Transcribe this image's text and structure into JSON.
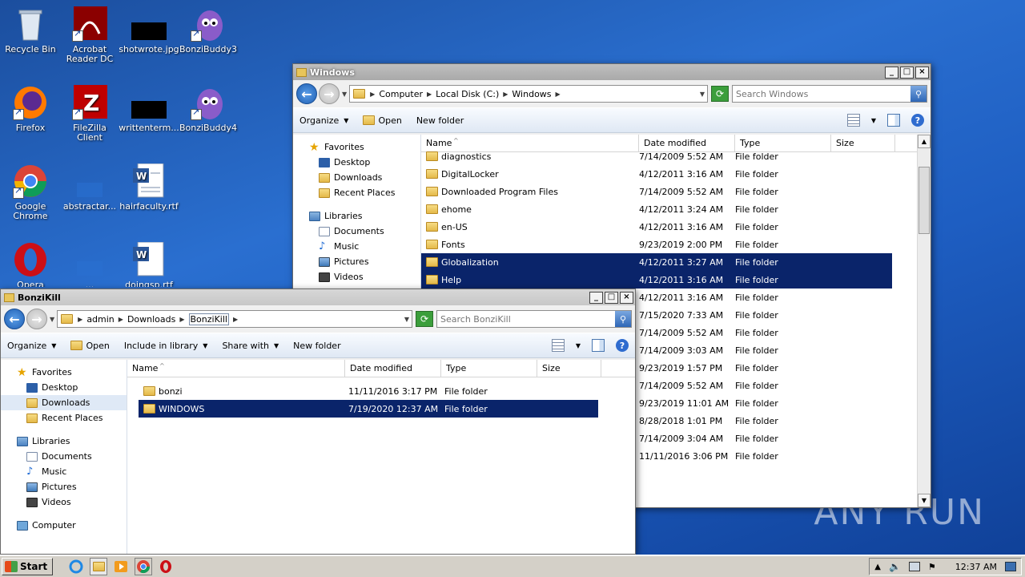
{
  "desktop": {
    "icons": [
      {
        "label": "Recycle Bin",
        "icon": "recycle-bin-icon"
      },
      {
        "label": "Acrobat Reader DC",
        "icon": "acrobat-icon"
      },
      {
        "label": "shotwrote.jpg",
        "icon": "image-file-icon"
      },
      {
        "label": "BonziBuddy3",
        "icon": "bonzibuddy-icon"
      },
      {
        "label": "Firefox",
        "icon": "firefox-icon"
      },
      {
        "label": "FileZilla Client",
        "icon": "filezilla-icon"
      },
      {
        "label": "writtenterm...",
        "icon": "image-file-icon"
      },
      {
        "label": "BonziBuddy4",
        "icon": "bonzibuddy-icon"
      },
      {
        "label": "Google Chrome",
        "icon": "chrome-icon"
      },
      {
        "label": "abstractar...",
        "icon": "file-icon"
      },
      {
        "label": "hairfaculty.rtf",
        "icon": "word-doc-icon"
      },
      {
        "label": "Opera",
        "icon": "opera-icon"
      },
      {
        "label": "...",
        "icon": "file-icon"
      },
      {
        "label": "doingsp.rtf",
        "icon": "word-doc-icon"
      }
    ],
    "watermark": "ANY RUN"
  },
  "windows_explorer": {
    "title": "Windows",
    "breadcrumb": [
      "Computer",
      "Local Disk (C:)",
      "Windows"
    ],
    "search_placeholder": "Search Windows",
    "toolbar": {
      "organize": "Organize",
      "open": "Open",
      "new_folder": "New folder"
    },
    "nav": {
      "favorites": "Favorites",
      "favorites_items": [
        "Desktop",
        "Downloads",
        "Recent Places"
      ],
      "libraries": "Libraries",
      "library_items": [
        "Documents",
        "Music",
        "Pictures",
        "Videos"
      ]
    },
    "columns": [
      "Name",
      "Date modified",
      "Type",
      "Size"
    ],
    "rows": [
      {
        "name": "diagnostics",
        "date": "7/14/2009 5:52 AM",
        "type": "File folder",
        "selected": false
      },
      {
        "name": "DigitalLocker",
        "date": "4/12/2011 3:16 AM",
        "type": "File folder",
        "selected": false
      },
      {
        "name": "Downloaded Program Files",
        "date": "7/14/2009 5:52 AM",
        "type": "File folder",
        "selected": false
      },
      {
        "name": "ehome",
        "date": "4/12/2011 3:24 AM",
        "type": "File folder",
        "selected": false
      },
      {
        "name": "en-US",
        "date": "4/12/2011 3:16 AM",
        "type": "File folder",
        "selected": false
      },
      {
        "name": "Fonts",
        "date": "9/23/2019 2:00 PM",
        "type": "File folder",
        "selected": false
      },
      {
        "name": "Globalization",
        "date": "4/12/2011 3:27 AM",
        "type": "File folder",
        "selected": true
      },
      {
        "name": "Help",
        "date": "4/12/2011 3:16 AM",
        "type": "File folder",
        "selected": true
      },
      {
        "name": "",
        "date": "4/12/2011 3:16 AM",
        "type": "File folder",
        "selected": false
      },
      {
        "name": "",
        "date": "7/15/2020 7:33 AM",
        "type": "File folder",
        "selected": false
      },
      {
        "name": "",
        "date": "7/14/2009 5:52 AM",
        "type": "File folder",
        "selected": false
      },
      {
        "name": "",
        "date": "7/14/2009 3:03 AM",
        "type": "File folder",
        "selected": false
      },
      {
        "name": "",
        "date": "9/23/2019 1:57 PM",
        "type": "File folder",
        "selected": false
      },
      {
        "name": "",
        "date": "7/14/2009 5:52 AM",
        "type": "File folder",
        "selected": false
      },
      {
        "name": "",
        "date": "9/23/2019 11:01 AM",
        "type": "File folder",
        "selected": false
      },
      {
        "name": "",
        "date": "8/28/2018 1:01 PM",
        "type": "File folder",
        "selected": false
      },
      {
        "name": "",
        "date": "7/14/2009 3:04 AM",
        "type": "File folder",
        "selected": false
      },
      {
        "name": "",
        "date": "11/11/2016 3:06 PM",
        "type": "File folder",
        "selected": false
      }
    ]
  },
  "bonzikill_explorer": {
    "title": "BonziKill",
    "breadcrumb": [
      "admin",
      "Downloads",
      "BonziKill"
    ],
    "search_placeholder": "Search BonziKill",
    "toolbar": {
      "organize": "Organize",
      "open": "Open",
      "include": "Include in library",
      "share": "Share with",
      "new_folder": "New folder"
    },
    "nav": {
      "favorites": "Favorites",
      "favorites_items": [
        "Desktop",
        "Downloads",
        "Recent Places"
      ],
      "libraries": "Libraries",
      "library_items": [
        "Documents",
        "Music",
        "Pictures",
        "Videos"
      ],
      "computer": "Computer"
    },
    "columns": [
      "Name",
      "Date modified",
      "Type",
      "Size"
    ],
    "rows": [
      {
        "name": "bonzi",
        "date": "11/11/2016 3:17 PM",
        "type": "File folder",
        "selected": false
      },
      {
        "name": "WINDOWS",
        "date": "7/19/2020 12:37 AM",
        "type": "File folder",
        "selected": true
      }
    ]
  },
  "taskbar": {
    "start": "Start",
    "quicklaunch": [
      "ie-icon",
      "explorer-icon",
      "media-player-icon",
      "chrome-icon",
      "opera-icon"
    ],
    "clock": "12:37 AM"
  }
}
